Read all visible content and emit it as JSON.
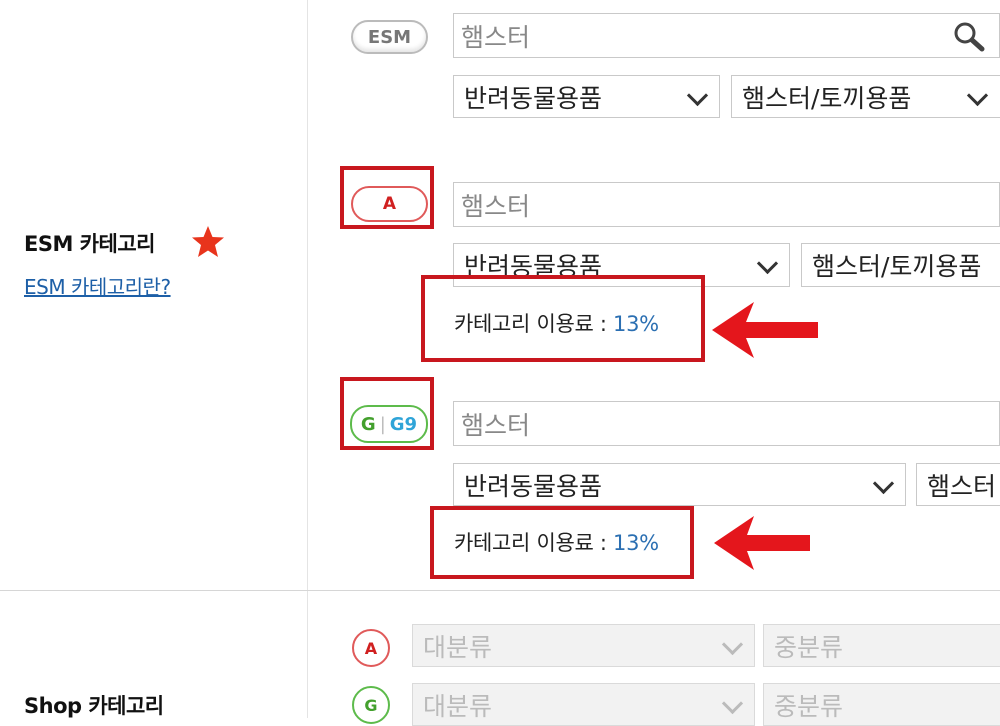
{
  "esm_category": {
    "label": "ESM 카테고리",
    "help_link": "ESM 카테고리란?",
    "star_icon": "star-icon",
    "esm_row": {
      "badge": "ESM",
      "search_value": "햄스터",
      "select1": "반려동물용품",
      "select2": "햄스터/토끼용품"
    },
    "auction_row": {
      "badge": "A",
      "search_value": "햄스터",
      "select1": "반려동물용품",
      "select2": "햄스터/토끼용품",
      "fee_label": "카테고리 이용료 : ",
      "fee_value": "13%"
    },
    "gmarket_row": {
      "badge_g": "G",
      "badge_g9": "G9",
      "search_value": "햄스터",
      "select1": "반려동물용품",
      "select2": "햄스터",
      "fee_label": "카테고리 이용료 : ",
      "fee_value": "13%"
    }
  },
  "shop_category": {
    "label": "Shop 카테고리",
    "auction": {
      "badge": "A",
      "major": "대분류",
      "middle": "중분류"
    },
    "gmarket": {
      "badge": "G",
      "major": "대분류",
      "middle": "중분류"
    }
  },
  "colors": {
    "highlight_red": "#c8171e",
    "link_blue": "#1d5fa7",
    "fee_blue": "#2b6fb2"
  }
}
